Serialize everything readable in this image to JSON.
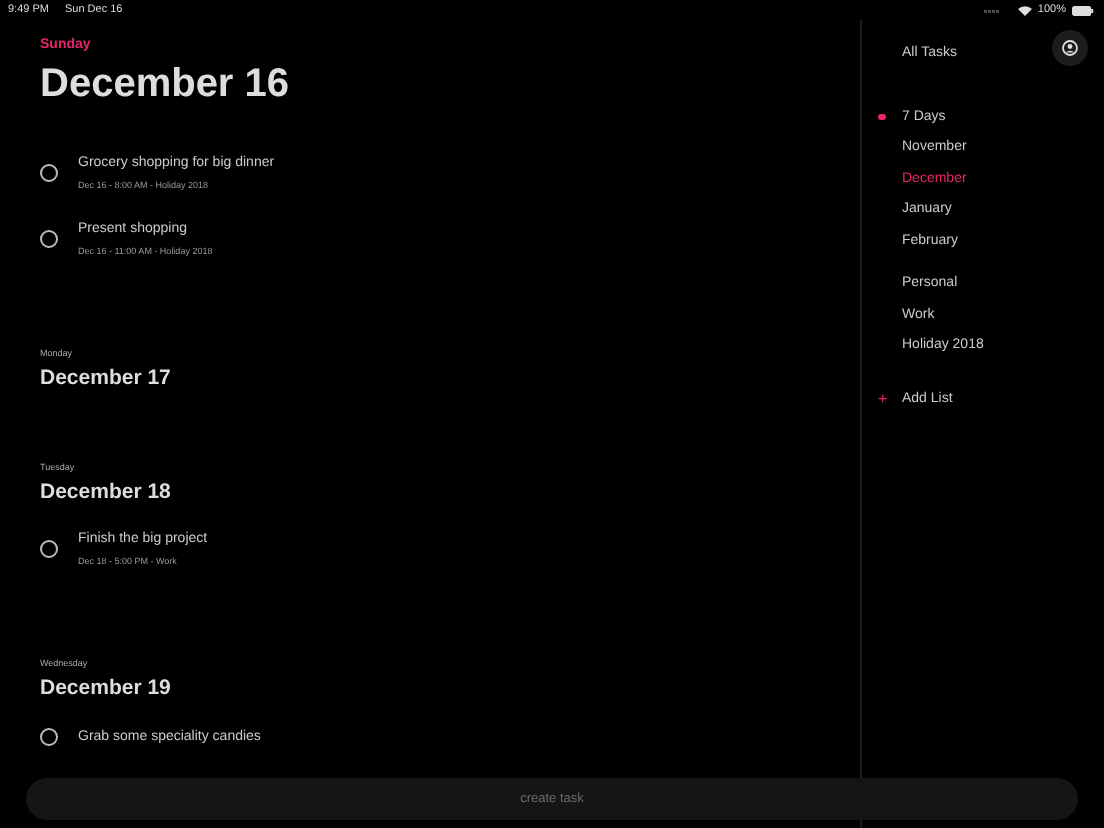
{
  "status_bar": {
    "time": "9:49 PM",
    "date": "Sun Dec 16",
    "battery": "100%"
  },
  "days": [
    {
      "weekday": "Sunday",
      "title": "December 16",
      "today": true,
      "tasks": [
        {
          "title": "Grocery shopping for big dinner",
          "meta": "Dec 16 - 8:00 AM - Holiday 2018",
          "done": false
        },
        {
          "title": "Present shopping",
          "meta": "Dec 16 - 11:00 AM - Holiday 2018",
          "done": false
        }
      ]
    },
    {
      "weekday": "Monday",
      "title": "December 17",
      "today": false
    },
    {
      "weekday": "Tuesday",
      "title": "December 18",
      "today": false,
      "tasks": [
        {
          "title": "Finish the big project",
          "meta": "Dec 18 - 5:00 PM - Work",
          "done": false
        }
      ]
    },
    {
      "weekday": "Wednesday",
      "title": "December 19",
      "today": false,
      "tasks": [
        {
          "title": "Grab some speciality candies",
          "done": false
        }
      ]
    }
  ],
  "sidebar": {
    "all_tasks": "All Tasks",
    "groups": [
      [
        {
          "label": "7 Days",
          "selected": false,
          "dot": true
        },
        {
          "label": "November",
          "selected": false,
          "dot": false
        },
        {
          "label": "December",
          "selected": true,
          "dot": false
        },
        {
          "label": "January",
          "selected": false,
          "dot": false
        },
        {
          "label": "February",
          "selected": false,
          "dot": false
        }
      ],
      [
        {
          "label": "Personal",
          "selected": false,
          "dot": false
        },
        {
          "label": "Work",
          "selected": false,
          "dot": false
        },
        {
          "label": "Holiday 2018",
          "selected": false,
          "dot": false
        }
      ]
    ],
    "add_list": {
      "icon": "+",
      "label": "Add List"
    }
  },
  "create_task": {
    "placeholder": "create task"
  }
}
